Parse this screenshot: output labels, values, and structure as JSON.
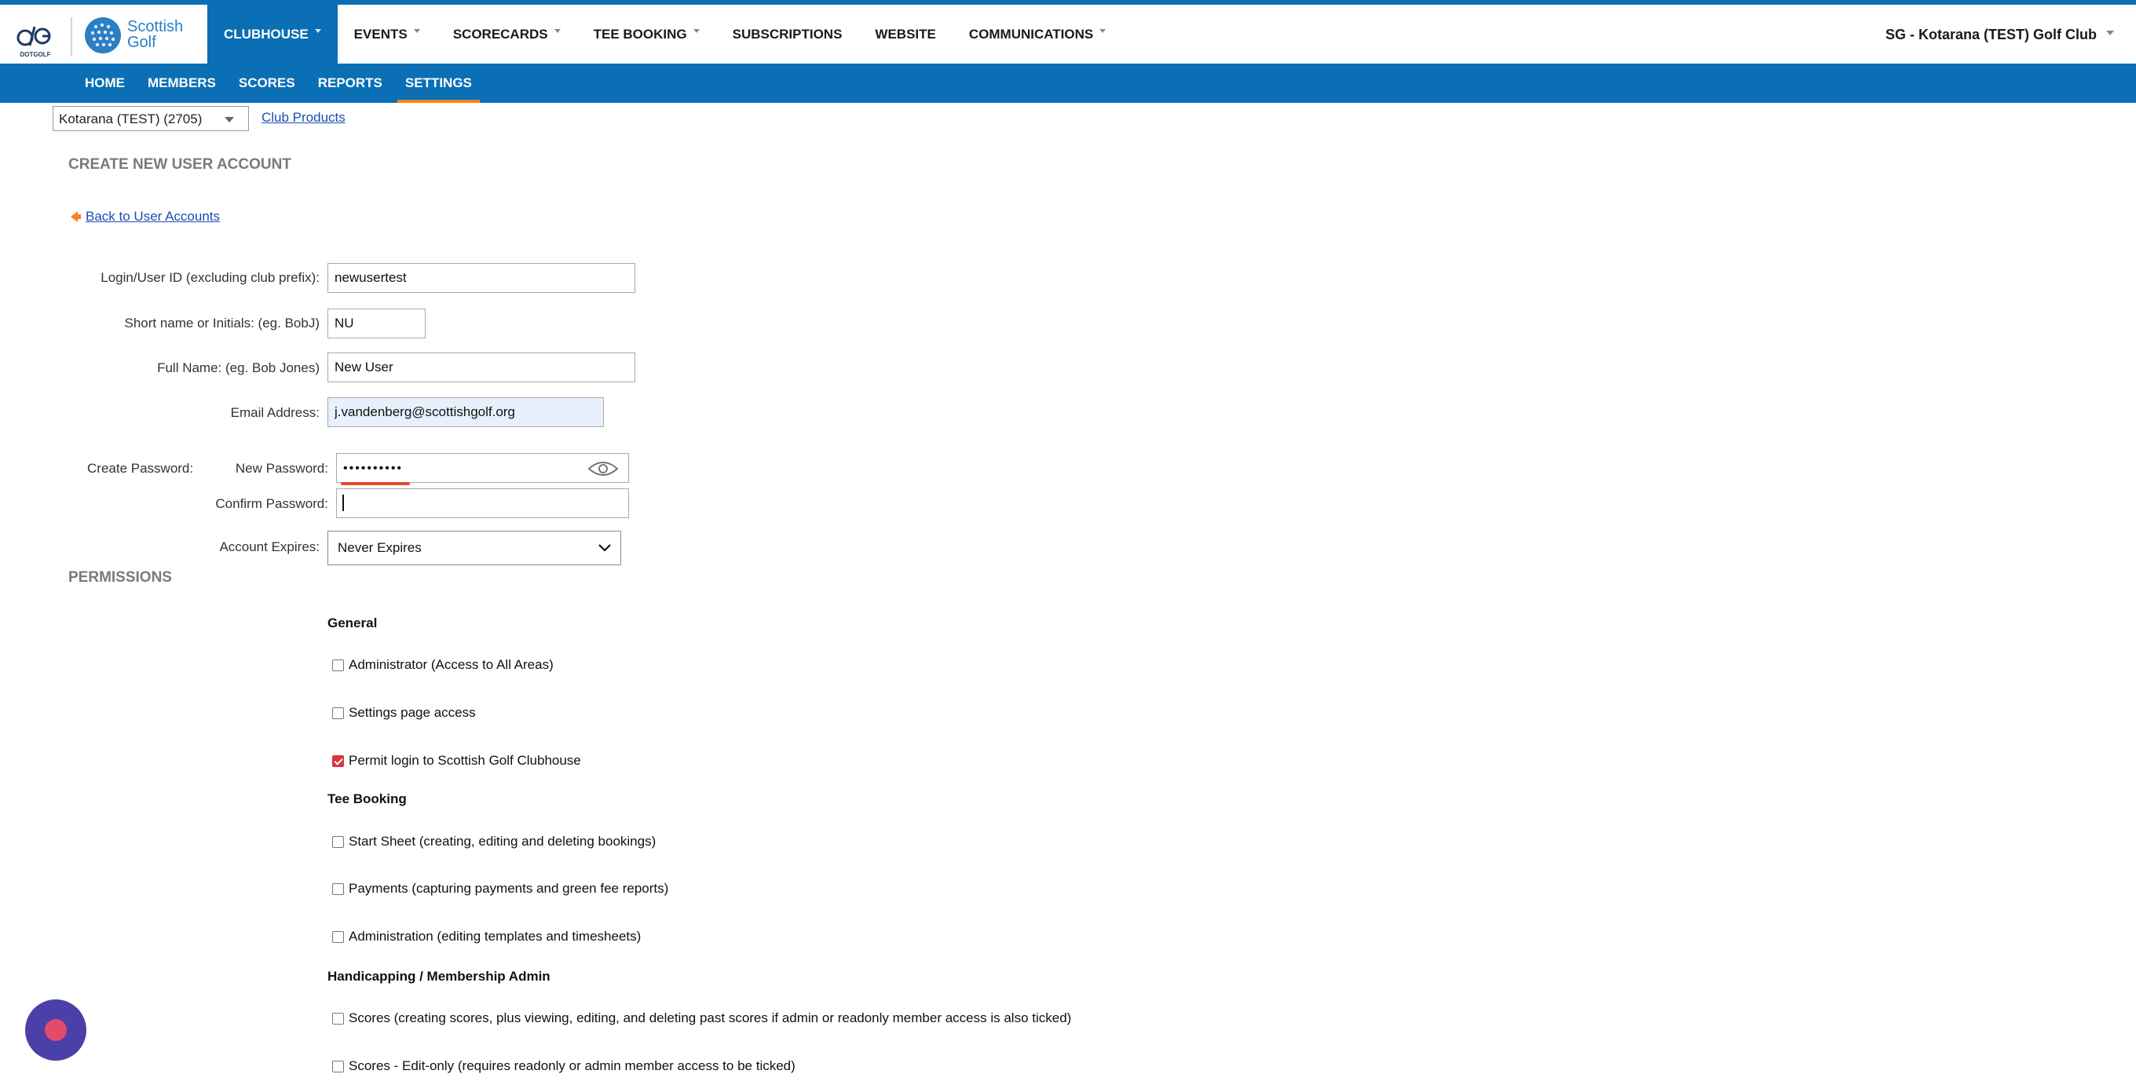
{
  "colors": {
    "brand_blue": "#0a6fb5",
    "accent_orange": "#f5821f",
    "check_red": "#d9363e"
  },
  "header": {
    "logo_dotgolf_text": "DOTGOLF",
    "logo_sg_line1": "Scottish",
    "logo_sg_line2": "Golf",
    "nav": [
      {
        "label": "CLUBHOUSE",
        "dropdown": true,
        "active": true
      },
      {
        "label": "EVENTS",
        "dropdown": true
      },
      {
        "label": "SCORECARDS",
        "dropdown": true
      },
      {
        "label": "TEE BOOKING",
        "dropdown": true
      },
      {
        "label": "SUBSCRIPTIONS",
        "dropdown": false
      },
      {
        "label": "WEBSITE",
        "dropdown": false
      },
      {
        "label": "COMMUNICATIONS",
        "dropdown": true
      }
    ],
    "club_name": "SG - Kotarana (TEST) Golf Club"
  },
  "subnav": {
    "items": [
      {
        "label": "HOME"
      },
      {
        "label": "MEMBERS"
      },
      {
        "label": "SCORES"
      },
      {
        "label": "REPORTS"
      },
      {
        "label": "SETTINGS",
        "active": true
      }
    ]
  },
  "toolbar": {
    "club_select_value": "Kotarana (TEST) (2705)",
    "club_products_link": "Club Products"
  },
  "page": {
    "title": "CREATE NEW USER ACCOUNT",
    "back_link": "Back to User Accounts",
    "permissions_title": "PERMISSIONS"
  },
  "form": {
    "login_label": "Login/User ID (excluding club prefix):",
    "login_value": "newusertest",
    "short_label": "Short name or Initials: (eg. BobJ)",
    "short_value": "NU",
    "fullname_label": "Full Name: (eg. Bob Jones)",
    "fullname_value": "New User",
    "email_label": "Email Address:",
    "email_value": "j.vandenberg@scottishgolf.org",
    "create_password_label": "Create Password:",
    "new_password_label": "New Password:",
    "new_password_value": "••••••••••",
    "confirm_password_label": "Confirm Password:",
    "confirm_password_value": "",
    "expires_label": "Account Expires:",
    "expires_value": "Never Expires"
  },
  "permissions": {
    "groups": [
      {
        "title": "General",
        "items": [
          {
            "label": "Administrator (Access to All Areas)",
            "checked": false
          },
          {
            "label": "Settings page access",
            "checked": false
          },
          {
            "label": "Permit login to Scottish Golf Clubhouse",
            "checked": true
          }
        ]
      },
      {
        "title": "Tee Booking",
        "items": [
          {
            "label": "Start Sheet (creating, editing and deleting bookings)",
            "checked": false
          },
          {
            "label": "Payments (capturing payments and green fee reports)",
            "checked": false
          },
          {
            "label": "Administration (editing templates and timesheets)",
            "checked": false
          }
        ]
      },
      {
        "title": "Handicapping / Membership Admin",
        "items": [
          {
            "label": "Scores (creating scores, plus viewing, editing, and deleting past scores if admin or readonly member access is also ticked)",
            "checked": false
          },
          {
            "label": "Scores - Edit-only (requires readonly or admin member access to be ticked)",
            "checked": false
          }
        ]
      }
    ]
  }
}
